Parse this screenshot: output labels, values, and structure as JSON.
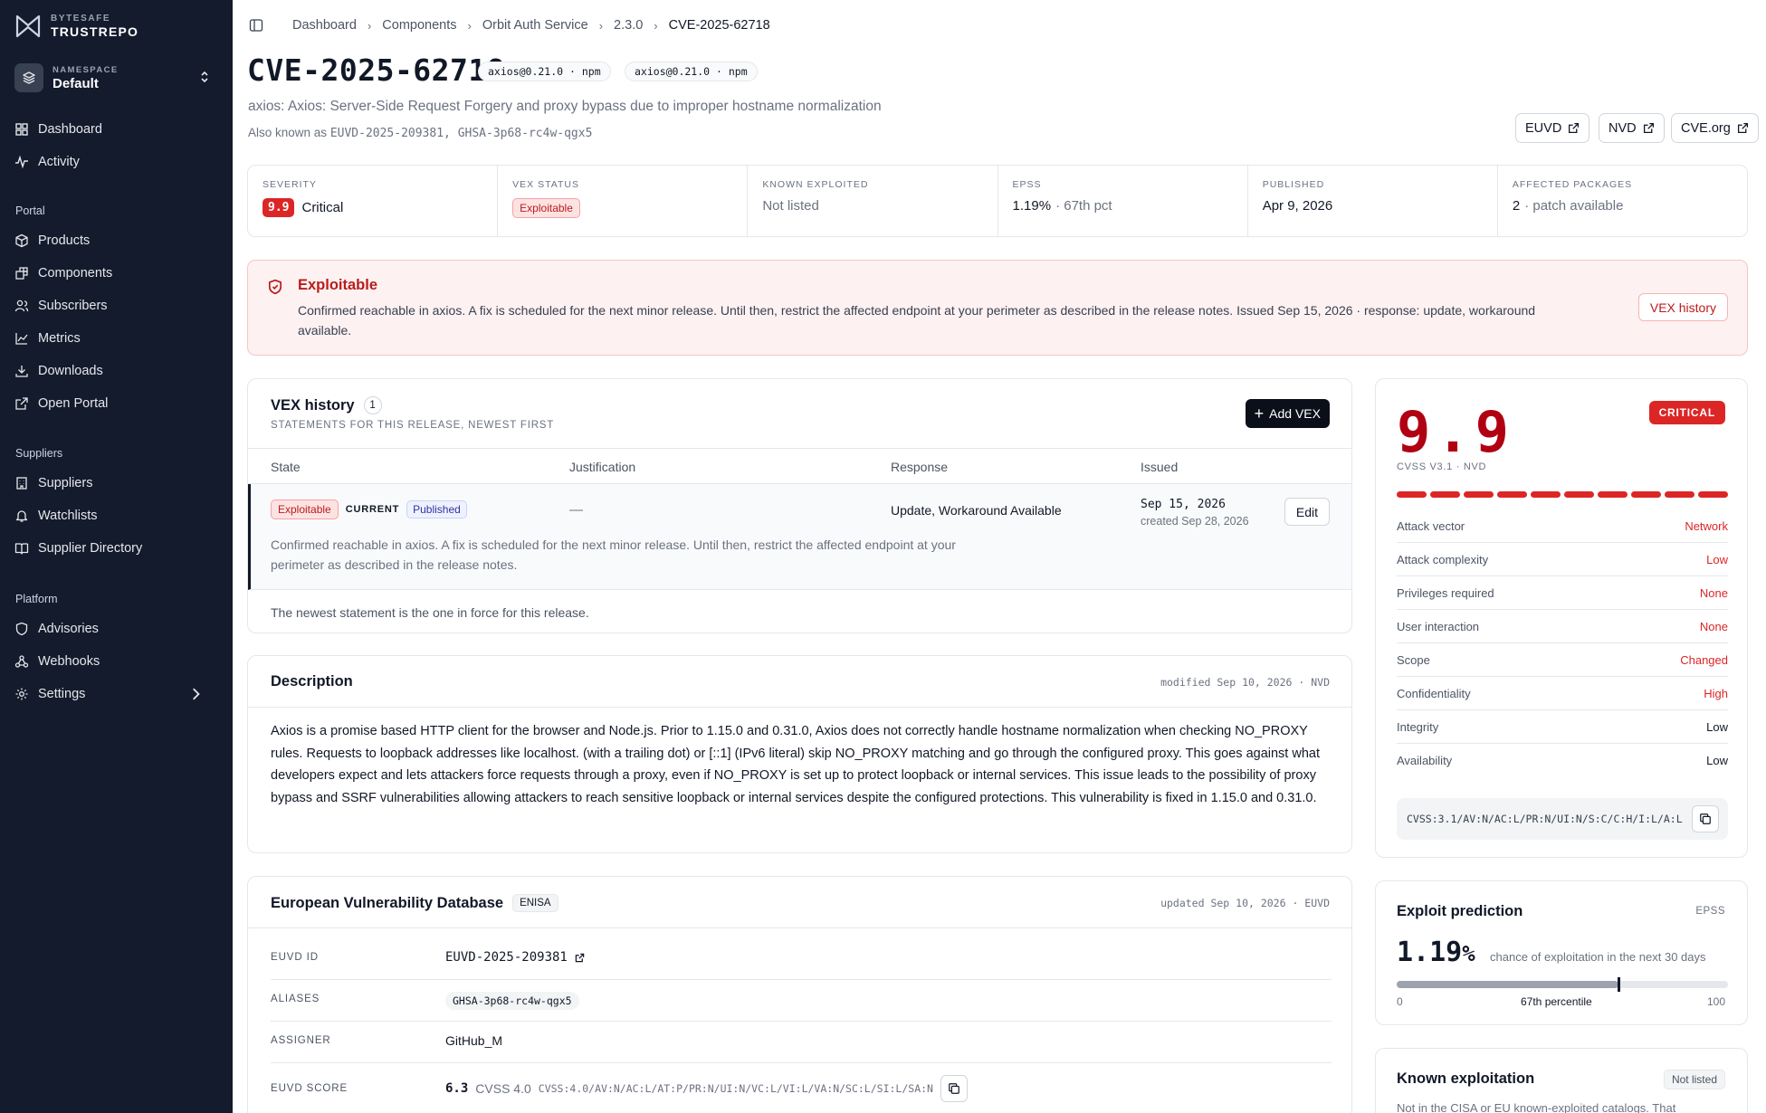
{
  "brand": {
    "top": "BYTESAFE",
    "name": "TRUSTREPO"
  },
  "namespace": {
    "label": "NAMESPACE",
    "value": "Default"
  },
  "nav": {
    "main": [
      "Dashboard",
      "Activity"
    ],
    "portal_label": "Portal",
    "portal": [
      "Products",
      "Components",
      "Subscribers",
      "Metrics",
      "Downloads",
      "Open Portal"
    ],
    "suppliers_label": "Suppliers",
    "suppliers": [
      "Suppliers",
      "Watchlists",
      "Supplier Directory"
    ],
    "platform_label": "Platform",
    "platform": [
      "Advisories",
      "Webhooks",
      "Settings"
    ]
  },
  "breadcrumb": [
    "Dashboard",
    "Components",
    "Orbit Auth Service",
    "2.3.0",
    "CVE-2025-62718"
  ],
  "header": {
    "cve_id": "CVE-2025-62718",
    "tags": [
      "axios@0.21.0 · npm",
      "axios@0.21.0 · npm"
    ],
    "subtitle": "axios: Axios: Server-Side Request Forgery and proxy bypass due to improper hostname normalization",
    "aka_prefix": "Also known as",
    "aka_ids": "EUVD-2025-209381, GHSA-3p68-rc4w-qgx5",
    "links": [
      "EUVD",
      "NVD",
      "CVE.org"
    ]
  },
  "stats": {
    "severity_label": "SEVERITY",
    "severity_score": "9.9",
    "severity_text": "Critical",
    "vex_label": "VEX STATUS",
    "vex_value": "Exploitable",
    "known_label": "KNOWN EXPLOITED",
    "known_value": "Not listed",
    "epss_label": "EPSS",
    "epss_value": "1.19%",
    "epss_pct": "· 67th pct",
    "published_label": "PUBLISHED",
    "published_value": "Apr 9, 2026",
    "affected_label": "AFFECTED PACKAGES",
    "affected_count": "2",
    "affected_note": "· patch available"
  },
  "alert": {
    "title": "Exploitable",
    "text": "Confirmed reachable in axios. A fix is scheduled for the next minor release. Until then, restrict the affected endpoint at your perimeter as described in the release notes. Issued Sep 15, 2026 · response: update, workaround available.",
    "button": "VEX history"
  },
  "vex": {
    "title": "VEX history",
    "count": "1",
    "subtitle": "STATEMENTS FOR THIS RELEASE, NEWEST FIRST",
    "add_button": "Add VEX",
    "columns": [
      "State",
      "Justification",
      "Response",
      "Issued"
    ],
    "row": {
      "state": "Exploitable",
      "current": "CURRENT",
      "status": "Published",
      "justification": "—",
      "response": "Update, Workaround Available",
      "issued": "Sep 15, 2026",
      "created": "created Sep 28, 2026",
      "edit": "Edit",
      "note": "Confirmed reachable in axios. A fix is scheduled for the next minor release. Until then, restrict the affected endpoint at your perimeter as described in the release notes."
    },
    "footer": "The newest statement is the one in force for this release."
  },
  "description": {
    "title": "Description",
    "meta": "modified Sep 10, 2026 · NVD",
    "body": "Axios is a promise based HTTP client for the browser and Node.js. Prior to 1.15.0 and 0.31.0, Axios does not correctly handle hostname normalization when checking NO_PROXY rules. Requests to loopback addresses like localhost. (with a trailing dot) or [::1] (IPv6 literal) skip NO_PROXY matching and go through the configured proxy. This goes against what developers expect and lets attackers force requests through a proxy, even if NO_PROXY is set up to protect loopback or internal services. This issue leads to the possibility of proxy bypass and SSRF vulnerabilities allowing attackers to reach sensitive loopback or internal services despite the configured protections. This vulnerability is fixed in 1.15.0 and 0.31.0."
  },
  "euvd": {
    "title": "European Vulnerability Database",
    "tag": "ENISA",
    "meta": "updated Sep 10, 2026 · EUVD",
    "id_label": "EUVD ID",
    "id_value": "EUVD-2025-209381",
    "aliases_label": "ALIASES",
    "alias": "GHSA-3p68-rc4w-qgx5",
    "assigner_label": "ASSIGNER",
    "assigner": "GitHub_M",
    "score_label": "EUVD SCORE",
    "score": "6.3",
    "score_version": "CVSS 4.0",
    "score_vector": "CVSS:4.0/AV:N/AC:L/AT:P/PR:N/UI:N/VC:L/VI:L/VA:N/SC:L/SI:L/SA:N"
  },
  "cvss": {
    "score": "9.9",
    "label": "CVSS V3.1 · NVD",
    "badge": "CRITICAL",
    "bar_filled": 10,
    "bar_total": 10,
    "metrics": [
      {
        "k": "Attack vector",
        "v": "Network",
        "color": "#dc2626"
      },
      {
        "k": "Attack complexity",
        "v": "Low",
        "color": "#dc2626"
      },
      {
        "k": "Privileges required",
        "v": "None",
        "color": "#dc2626"
      },
      {
        "k": "User interaction",
        "v": "None",
        "color": "#dc2626"
      },
      {
        "k": "Scope",
        "v": "Changed",
        "color": "#dc2626"
      },
      {
        "k": "Confidentiality",
        "v": "High",
        "color": "#dc2626"
      },
      {
        "k": "Integrity",
        "v": "Low",
        "color": "#111827"
      },
      {
        "k": "Availability",
        "v": "Low",
        "color": "#111827"
      }
    ],
    "vector": "CVSS:3.1/AV:N/AC:L/PR:N/UI:N/S:C/C:H/I:L/A:L"
  },
  "epss": {
    "title": "Exploit prediction",
    "tag": "EPSS",
    "value": "1.19%",
    "caption": "chance of exploitation in the next 30 days",
    "percentile": 0.67,
    "percentile_label": "67th percentile",
    "min": "0",
    "max": "100"
  },
  "known": {
    "title": "Known exploitation",
    "tag": "Not listed",
    "text": "Not in the CISA or EU known-exploited catalogs. That"
  },
  "colors": {
    "sidebar": "#131b2c",
    "critical": "#dc2626",
    "score": "#b00012"
  }
}
